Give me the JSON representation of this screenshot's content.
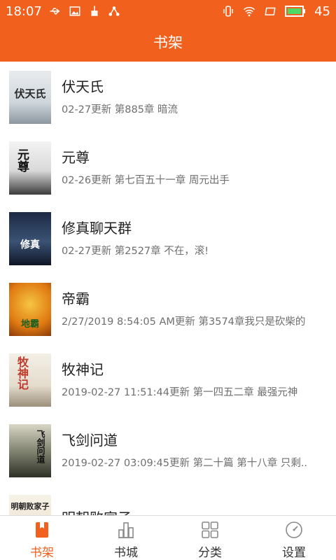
{
  "statusbar": {
    "time": "18:07",
    "battery": "45"
  },
  "header": {
    "title": "书架"
  },
  "books": [
    {
      "title": "伏天氏",
      "update": "02-27更新 第885章 暗流",
      "cover_text": "伏天氏"
    },
    {
      "title": "元尊",
      "update": "02-26更新 第七百五十一章 周元出手",
      "cover_text": "元尊"
    },
    {
      "title": "修真聊天群",
      "update": "02-27更新 第2527章 不在，滚!",
      "cover_text": "修真"
    },
    {
      "title": "帝霸",
      "update": "2/27/2019 8:54:05 AM更新 第3574章我只是砍柴的",
      "cover_text": "地霸"
    },
    {
      "title": "牧神记",
      "update": "2019-02-27 11:51:44更新 第一四五二章 最强元神",
      "cover_text": "牧神记"
    },
    {
      "title": "飞剑问道",
      "update": "2019-02-27 03:09:45更新 第二十篇 第十八章 只剩..",
      "cover_text": "飞剑问道"
    },
    {
      "title": "明朝败家子",
      "update": "",
      "cover_text": "明朝败家子"
    }
  ],
  "tabs": [
    {
      "label": "书架",
      "icon": "bookmark-icon",
      "active": true
    },
    {
      "label": "书城",
      "icon": "bar-chart-icon",
      "active": false
    },
    {
      "label": "分类",
      "icon": "grid-icon",
      "active": false
    },
    {
      "label": "设置",
      "icon": "compass-icon",
      "active": false
    }
  ],
  "colors": {
    "accent": "#f2601e",
    "text": "#222222",
    "subtext": "#6f6f6f"
  }
}
